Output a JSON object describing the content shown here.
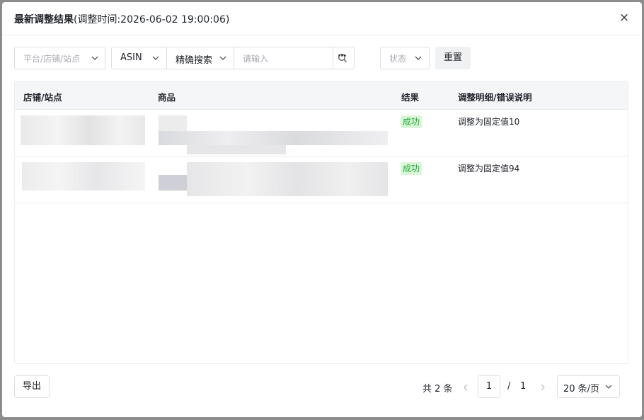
{
  "dialog": {
    "title": "最新调整结果",
    "subtitle": "(调整时间:2026-06-02 19:00:06)",
    "close_label": "×"
  },
  "filters": {
    "platform_placeholder": "平台/店铺/站点",
    "field_value": "ASIN",
    "match_value": "精确搜索",
    "search_placeholder": "请输入",
    "more_label": "···",
    "status_placeholder": "状态",
    "reset_label": "重置"
  },
  "table": {
    "columns": [
      "店铺/站点",
      "商品",
      "结果",
      "调整明细/错误说明"
    ],
    "rows": [
      {
        "result": "成功",
        "detail": "调整为固定值10"
      },
      {
        "result": "成功",
        "detail": "调整为固定值94"
      }
    ]
  },
  "footer": {
    "export_label": "导出",
    "total": "共 2 条",
    "page_current": "1",
    "page_sep": "/",
    "page_total": "1",
    "page_size": "20 条/页"
  },
  "colors": {
    "success_bg": "#d9f7d6",
    "success_text": "#20a83e",
    "border": "#dcdfe6"
  }
}
